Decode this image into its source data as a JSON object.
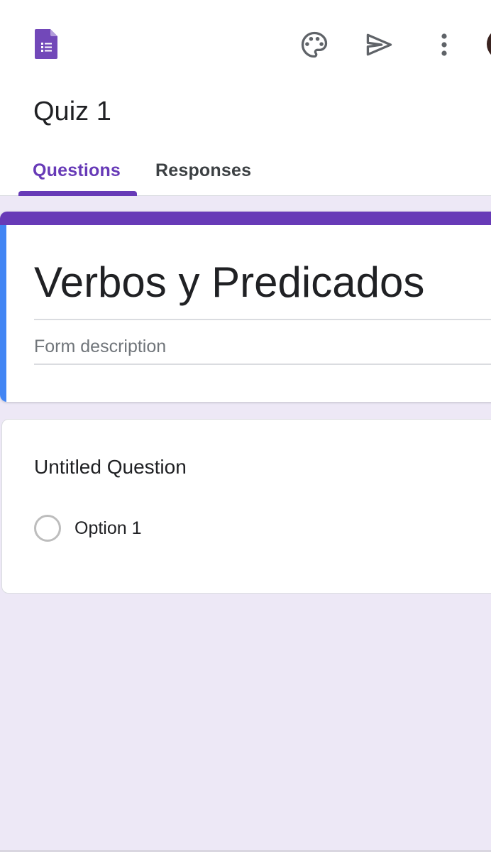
{
  "app": {
    "icon": "google-forms-icon"
  },
  "toolbar": {
    "palette_icon": "palette-icon",
    "send_icon": "send-icon",
    "more_icon": "more-vert-icon"
  },
  "document": {
    "title": "Quiz 1"
  },
  "tabs": [
    {
      "label": "Questions",
      "active": true
    },
    {
      "label": "Responses",
      "active": false
    }
  ],
  "form": {
    "title": "Verbos y Predicados",
    "description_placeholder": "Form description"
  },
  "questions": [
    {
      "title": "Untitled Question",
      "options": [
        {
          "label": "Option 1"
        }
      ]
    }
  ],
  "colors": {
    "accent": "#673ab7",
    "blue_bar": "#4285f4",
    "background": "#ede8f6"
  }
}
